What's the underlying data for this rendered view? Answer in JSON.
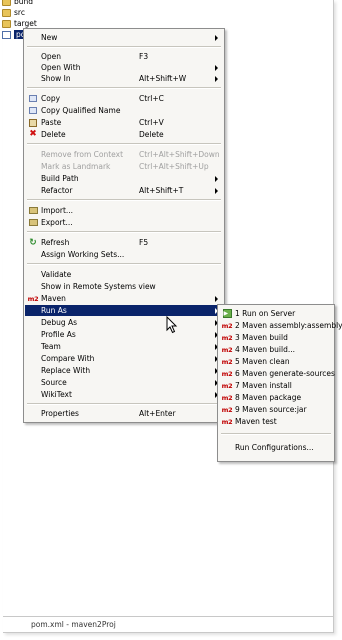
{
  "tree": {
    "items": [
      {
        "label": "bund",
        "type": "folder"
      },
      {
        "label": "src",
        "type": "folder"
      },
      {
        "label": "target",
        "type": "folder"
      },
      {
        "label": "pom",
        "type": "file"
      }
    ]
  },
  "context_menu": {
    "items": [
      {
        "label": "New",
        "shortcut": "",
        "submenu": true
      },
      {
        "label": "Open",
        "shortcut": "F3"
      },
      {
        "label": "Open With",
        "shortcut": "",
        "submenu": true
      },
      {
        "label": "Show In",
        "shortcut": "Alt+Shift+W",
        "submenu": true
      },
      {
        "label": "Copy",
        "shortcut": "Ctrl+C",
        "icon": "copy-icon"
      },
      {
        "label": "Copy Qualified Name",
        "shortcut": "",
        "icon": "copy-qualified-name-icon"
      },
      {
        "label": "Paste",
        "shortcut": "Ctrl+V",
        "icon": "paste-icon"
      },
      {
        "label": "Delete",
        "shortcut": "Delete",
        "icon": "delete-icon"
      },
      {
        "label": "Remove from Context",
        "shortcut": "Ctrl+Alt+Shift+Down",
        "disabled": true
      },
      {
        "label": "Mark as Landmark",
        "shortcut": "Ctrl+Alt+Shift+Up",
        "disabled": true
      },
      {
        "label": "Build Path",
        "shortcut": "",
        "submenu": true
      },
      {
        "label": "Refactor",
        "shortcut": "Alt+Shift+T",
        "submenu": true
      },
      {
        "label": "Import...",
        "shortcut": "",
        "icon": "import-icon"
      },
      {
        "label": "Export...",
        "shortcut": "",
        "icon": "export-icon"
      },
      {
        "label": "Refresh",
        "shortcut": "F5",
        "icon": "refresh-icon"
      },
      {
        "label": "Assign Working Sets...",
        "shortcut": ""
      },
      {
        "label": "Validate",
        "shortcut": ""
      },
      {
        "label": "Show in Remote Systems view",
        "shortcut": ""
      },
      {
        "label": "Maven",
        "shortcut": "",
        "submenu": true,
        "icon": "maven-m2-icon"
      },
      {
        "label": "Run As",
        "shortcut": "",
        "submenu": true,
        "highlighted": true
      },
      {
        "label": "Debug As",
        "shortcut": "",
        "submenu": true
      },
      {
        "label": "Profile As",
        "shortcut": "",
        "submenu": true
      },
      {
        "label": "Team",
        "shortcut": "",
        "submenu": true
      },
      {
        "label": "Compare With",
        "shortcut": "",
        "submenu": true
      },
      {
        "label": "Replace With",
        "shortcut": "",
        "submenu": true
      },
      {
        "label": "Source",
        "shortcut": "",
        "submenu": true
      },
      {
        "label": "WikiText",
        "shortcut": "",
        "submenu": true
      },
      {
        "label": "Properties",
        "shortcut": "Alt+Enter"
      }
    ]
  },
  "run_as_submenu": {
    "items": [
      {
        "label": "1 Run on Server",
        "icon": "run-on-server-icon"
      },
      {
        "label": "2 Maven assembly:assembly",
        "icon": "maven-m2-icon"
      },
      {
        "label": "3 Maven build",
        "icon": "maven-m2-icon"
      },
      {
        "label": "4 Maven build...",
        "icon": "maven-m2-icon"
      },
      {
        "label": "5 Maven clean",
        "icon": "maven-m2-icon"
      },
      {
        "label": "6 Maven generate-sources",
        "icon": "maven-m2-icon"
      },
      {
        "label": "7 Maven install",
        "icon": "maven-m2-icon"
      },
      {
        "label": "8 Maven package",
        "icon": "maven-m2-icon"
      },
      {
        "label": "9 Maven source:jar",
        "icon": "maven-m2-icon"
      },
      {
        "label": "Maven test",
        "icon": "maven-m2-icon"
      },
      {
        "label": "Run Configurations...",
        "icon": ""
      }
    ]
  },
  "maven_icon_text": "m2",
  "status_bar": {
    "text": "pom.xml - maven2Proj"
  },
  "colors": {
    "highlight": "#0a246a",
    "menu_bg": "#f7f6f3",
    "maven_red": "#c00000"
  }
}
